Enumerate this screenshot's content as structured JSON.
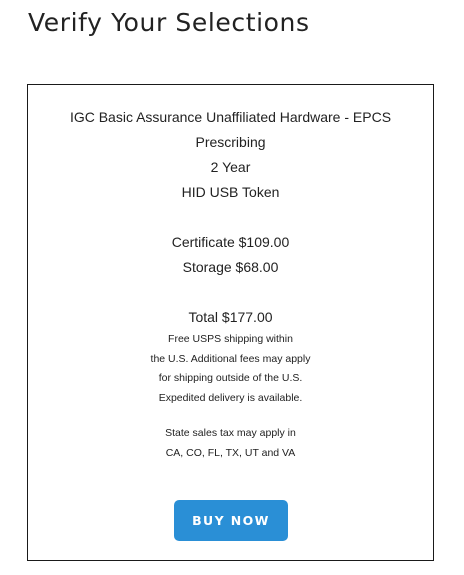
{
  "page": {
    "title": "Verify Your Selections"
  },
  "selection": {
    "product_line1": "IGC Basic Assurance Unaffiliated Hardware - EPCS",
    "product_line2": "Prescribing",
    "term": "2 Year",
    "device": "HID USB Token"
  },
  "pricing": {
    "certificate": "Certificate $109.00",
    "storage": "Storage $68.00",
    "total": "Total $177.00"
  },
  "notes": {
    "shipping_lines": [
      "Free USPS shipping within",
      "the U.S. Additional fees may apply",
      "for shipping outside of the U.S.",
      "Expedited delivery is available."
    ],
    "tax_lines": [
      "State sales tax may apply in",
      "CA, CO, FL, TX, UT and VA"
    ]
  },
  "actions": {
    "buy_label": "BUY NOW"
  },
  "colors": {
    "button_background": "#2a8fd6",
    "button_text": "#ffffff",
    "border": "#1a1a1a",
    "text": "#222222"
  }
}
